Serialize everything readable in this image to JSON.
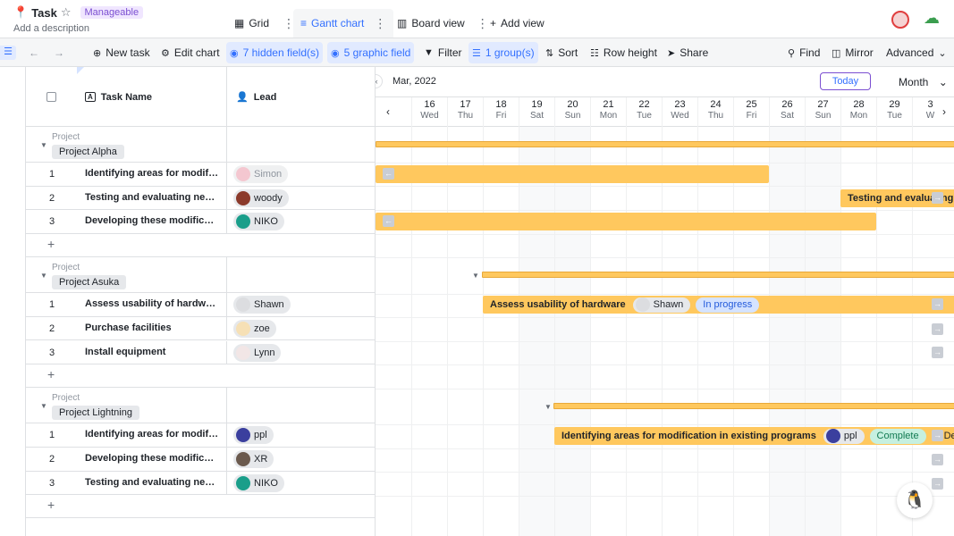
{
  "header": {
    "title": "Task",
    "badge": "Manageable",
    "description": "Add a description",
    "views": [
      {
        "label": "Grid"
      },
      {
        "label": "Gantt chart"
      },
      {
        "label": "Board view"
      }
    ],
    "add_view": "Add view"
  },
  "toolbar": {
    "new_task": "New task",
    "edit_chart": "Edit chart",
    "hidden_fields": "7 hidden field(s)",
    "graphic_field": "5 graphic field",
    "filter": "Filter",
    "group": "1 group(s)",
    "sort": "Sort",
    "row_height": "Row height",
    "share": "Share",
    "find": "Find",
    "mirror": "Mirror",
    "advanced": "Advanced"
  },
  "grid": {
    "columns": {
      "task_name": "Task Name",
      "lead": "Lead"
    },
    "group_label": "Project",
    "groups": [
      {
        "name": "Project Alpha",
        "rows": [
          {
            "num": "1",
            "task": "Identifying areas for modification in existing programs",
            "lead": "Simon",
            "faded": true,
            "avatar_color": "#f4c7d0"
          },
          {
            "num": "2",
            "task": "Testing and evaluating new programs",
            "lead": "woody",
            "faded": false,
            "avatar_color": "#8b3a2b"
          },
          {
            "num": "3",
            "task": "Developing these modifications",
            "lead": "NIKO",
            "faded": false,
            "avatar_color": "#1a9e8a"
          }
        ]
      },
      {
        "name": "Project Asuka",
        "rows": [
          {
            "num": "1",
            "task": "Assess usability of hardware",
            "lead": "Shawn",
            "faded": false,
            "avatar_color": "#dcdde0"
          },
          {
            "num": "2",
            "task": "Purchase facilities",
            "lead": "zoe",
            "faded": false,
            "avatar_color": "#f6e0b5"
          },
          {
            "num": "3",
            "task": "Install equipment",
            "lead": "Lynn",
            "faded": false,
            "avatar_color": "#f2e6e6"
          }
        ]
      },
      {
        "name": "Project Lightning",
        "rows": [
          {
            "num": "1",
            "task": "Identifying areas for modification in existing programs",
            "lead": "ppl",
            "faded": false,
            "avatar_color": "#3b3f9e"
          },
          {
            "num": "2",
            "task": "Developing these modifications",
            "lead": "XR",
            "faded": false,
            "avatar_color": "#6b5a4e"
          },
          {
            "num": "3",
            "task": "Testing and evaluating new programs",
            "lead": "NIKO",
            "faded": false,
            "avatar_color": "#1a9e8a"
          }
        ]
      }
    ],
    "add_symbol": "+"
  },
  "gantt": {
    "month_label": "Mar, 2022",
    "today_label": "Today",
    "scale_label": "Month",
    "days": [
      {
        "d": "16",
        "w": "Wed",
        "we": false
      },
      {
        "d": "17",
        "w": "Thu",
        "we": false
      },
      {
        "d": "18",
        "w": "Fri",
        "we": false
      },
      {
        "d": "19",
        "w": "Sat",
        "we": true
      },
      {
        "d": "20",
        "w": "Sun",
        "we": true
      },
      {
        "d": "21",
        "w": "Mon",
        "we": false
      },
      {
        "d": "22",
        "w": "Tue",
        "we": false
      },
      {
        "d": "23",
        "w": "Wed",
        "we": false
      },
      {
        "d": "24",
        "w": "Thu",
        "we": false
      },
      {
        "d": "25",
        "w": "Fri",
        "we": false
      },
      {
        "d": "26",
        "w": "Sat",
        "we": true
      },
      {
        "d": "27",
        "w": "Sun",
        "we": true
      },
      {
        "d": "28",
        "w": "Mon",
        "we": false
      },
      {
        "d": "29",
        "w": "Tue",
        "we": false
      },
      {
        "d": "3",
        "w": "W",
        "we": false
      }
    ],
    "bars": {
      "alpha_testing": "Testing and evaluating",
      "asuka_assess": "Assess usability of hardware",
      "asuka_assess_lead": "Shawn",
      "asuka_assess_status": "In progress",
      "lightning_identify": "Identifying areas for modification in existing programs",
      "lightning_identify_lead": "ppl",
      "lightning_identify_status": "Complete",
      "lightning_identify_extra": "Del"
    },
    "colors": {
      "bar": "#ffc85e",
      "accent": "#3370ff"
    }
  }
}
